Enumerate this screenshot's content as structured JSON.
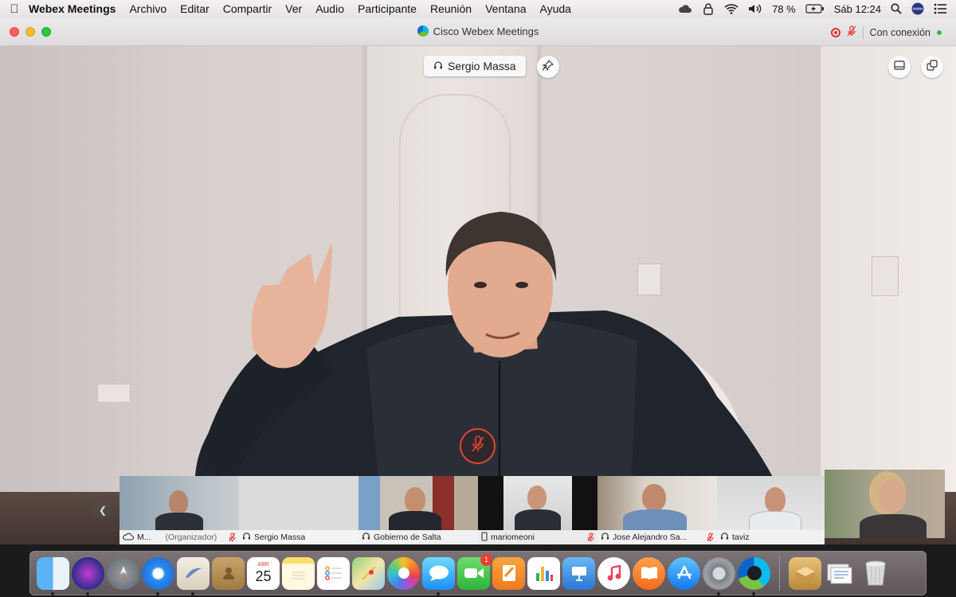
{
  "menubar": {
    "app_name": "Webex Meetings",
    "items": [
      "Archivo",
      "Editar",
      "Compartir",
      "Ver",
      "Audio",
      "Participante",
      "Reunión",
      "Ventana",
      "Ayuda"
    ],
    "battery": "78 %",
    "clock": "Sáb 12:24"
  },
  "window": {
    "title": "Cisco Webex Meetings",
    "connection_status": "Con conexión",
    "status_color": "#2bbf4c"
  },
  "stage": {
    "active_speaker": "Sergio Massa",
    "mute_color": "#e0462f"
  },
  "participants": [
    {
      "name": "M...",
      "role": "(Organizador)",
      "icon": "cloud-icon",
      "muted": true
    },
    {
      "name": "Sergio Massa",
      "role": "",
      "icon": "headset-icon",
      "muted": false
    },
    {
      "name": "Gobierno de Salta",
      "role": "",
      "icon": "headset-icon",
      "muted": false,
      "active": true
    },
    {
      "name": "mariomeoni",
      "role": "",
      "icon": "phone-icon",
      "muted": true
    },
    {
      "name": "Jose Alejandro Sa...",
      "role": "",
      "icon": "headset-icon",
      "muted": true
    },
    {
      "name": "taviz",
      "role": "",
      "icon": "headset-icon",
      "muted": false
    }
  ],
  "dock": {
    "calendar_month": "ABR",
    "calendar_day": "25",
    "facetime_badge": "1",
    "apps": [
      "finder-icon",
      "siri-icon",
      "launchpad-icon",
      "safari-icon",
      "mail-icon",
      "contacts-icon",
      "calendar-icon",
      "notes-icon",
      "reminders-icon",
      "maps-icon",
      "photos-icon",
      "messages-icon",
      "facetime-icon",
      "pages-icon",
      "numbers-icon",
      "keynote-icon",
      "music-icon",
      "books-icon",
      "app-store-icon",
      "system-preferences-icon",
      "webex-icon",
      "downloads-stack-icon",
      "documents-stack-icon",
      "trash-icon"
    ]
  }
}
